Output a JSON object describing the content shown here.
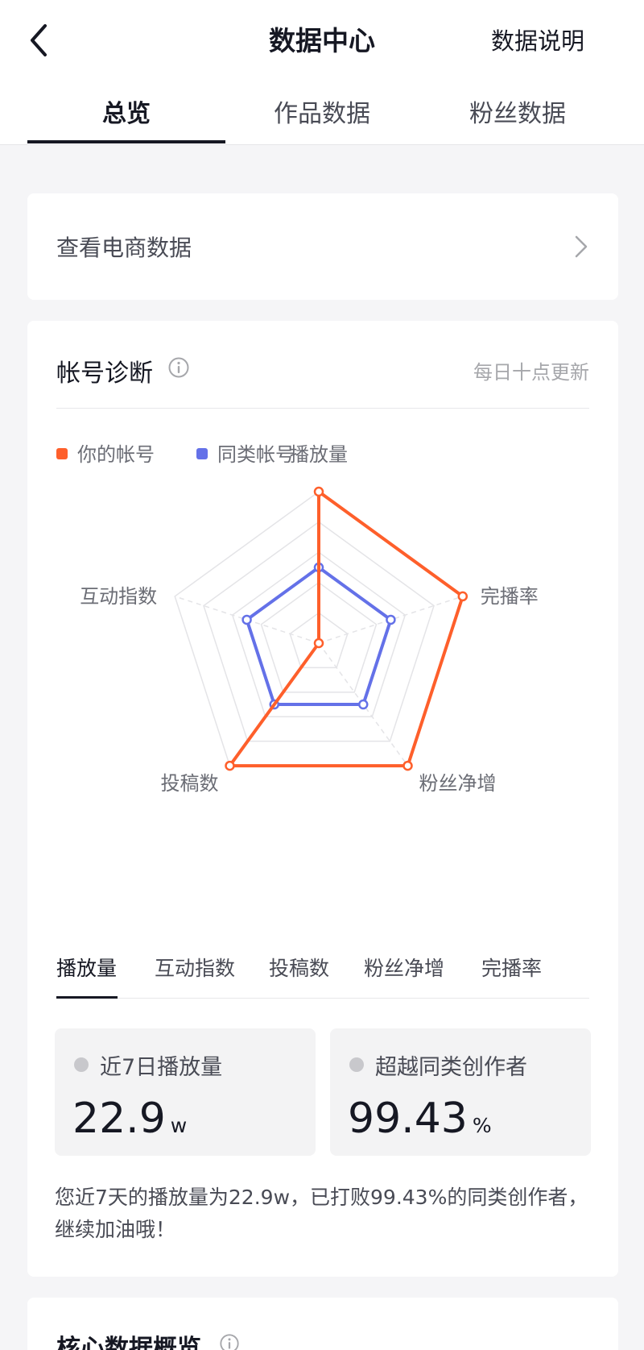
{
  "header": {
    "title": "数据中心",
    "help_label": "数据说明",
    "tabs": [
      {
        "label": "总览",
        "active": true
      },
      {
        "label": "作品数据",
        "active": false
      },
      {
        "label": "粉丝数据",
        "active": false
      }
    ]
  },
  "ecommerce": {
    "label": "查看电商数据"
  },
  "diagnosis": {
    "title": "帐号诊断",
    "update_note": "每日十点更新",
    "legend": [
      {
        "label": "你的帐号",
        "color": "#fe5f2b"
      },
      {
        "label": "同类帐号",
        "color": "#6471e8"
      }
    ],
    "chart_data": {
      "type": "radar",
      "axes": [
        "播放量",
        "完播率",
        "粉丝净增",
        "投稿数",
        "互动指数"
      ],
      "max": 5,
      "series": [
        {
          "name": "你的帐号",
          "color": "#fe5f2b",
          "values": [
            5,
            5,
            5,
            5,
            0
          ]
        },
        {
          "name": "同类帐号",
          "color": "#6471e8",
          "values": [
            2.5,
            2.5,
            2.5,
            2.5,
            2.5
          ]
        }
      ]
    },
    "metric_tabs": [
      {
        "label": "播放量",
        "active": true
      },
      {
        "label": "互动指数",
        "active": false
      },
      {
        "label": "投稿数",
        "active": false
      },
      {
        "label": "粉丝净增",
        "active": false
      },
      {
        "label": "完播率",
        "active": false
      }
    ],
    "stats": [
      {
        "label": "近7日播放量",
        "value": "22.9",
        "unit": "w"
      },
      {
        "label": "超越同类创作者",
        "value": "99.43",
        "unit": "%"
      }
    ],
    "summary": "您近7天的播放量为22.9w，已打败99.43%的同类创作者，继续加油哦！"
  },
  "core": {
    "title": "核心数据概览"
  }
}
